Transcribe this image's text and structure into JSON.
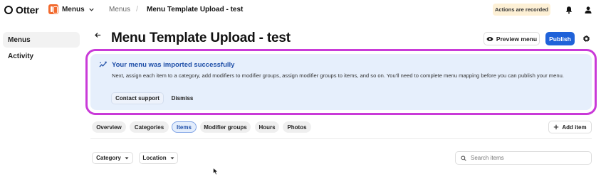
{
  "app": {
    "logo_text": "Otter",
    "switcher_label": "Menus"
  },
  "breadcrumb": {
    "parent": "Menus",
    "separator": "/",
    "current": "Menu Template Upload - test"
  },
  "status": {
    "recording": "Actions are recorded"
  },
  "sidebar": {
    "items": [
      {
        "label": "Menus",
        "active": true
      },
      {
        "label": "Activity",
        "active": false
      }
    ]
  },
  "header": {
    "title": "Menu Template Upload - test",
    "preview_label": "Preview menu",
    "publish_label": "Publish"
  },
  "banner": {
    "title": "Your menu was imported successfully",
    "body": "Next, assign each item to a category, add modifiers to modifier groups, assign modifier groups to items, and so on. You'll need to complete menu mapping before you can publish your menu.",
    "contact_label": "Contact support",
    "dismiss_label": "Dismiss"
  },
  "tabs": [
    {
      "label": "Overview",
      "active": false
    },
    {
      "label": "Categories",
      "active": false
    },
    {
      "label": "Items",
      "active": true
    },
    {
      "label": "Modifier groups",
      "active": false
    },
    {
      "label": "Hours",
      "active": false
    },
    {
      "label": "Photos",
      "active": false
    }
  ],
  "actions": {
    "add_item_label": "Add item"
  },
  "filters": {
    "category_label": "Category",
    "location_label": "Location"
  },
  "search": {
    "placeholder": "Search items",
    "value": ""
  },
  "colors": {
    "brand_orange": "#f26a2e",
    "primary_blue": "#1f62d9",
    "banner_bg": "#e6effc",
    "highlight_outline": "#c93ad8",
    "recording_bg": "#fdf0d5"
  },
  "icons": [
    "otter-logo-icon",
    "menus-app-icon",
    "chevron-down-icon",
    "bell-icon",
    "user-icon",
    "back-arrow-icon",
    "eye-icon",
    "gear-icon",
    "sparkle-trend-icon",
    "plus-icon",
    "caret-down-icon",
    "search-icon",
    "mouse-pointer-icon"
  ]
}
